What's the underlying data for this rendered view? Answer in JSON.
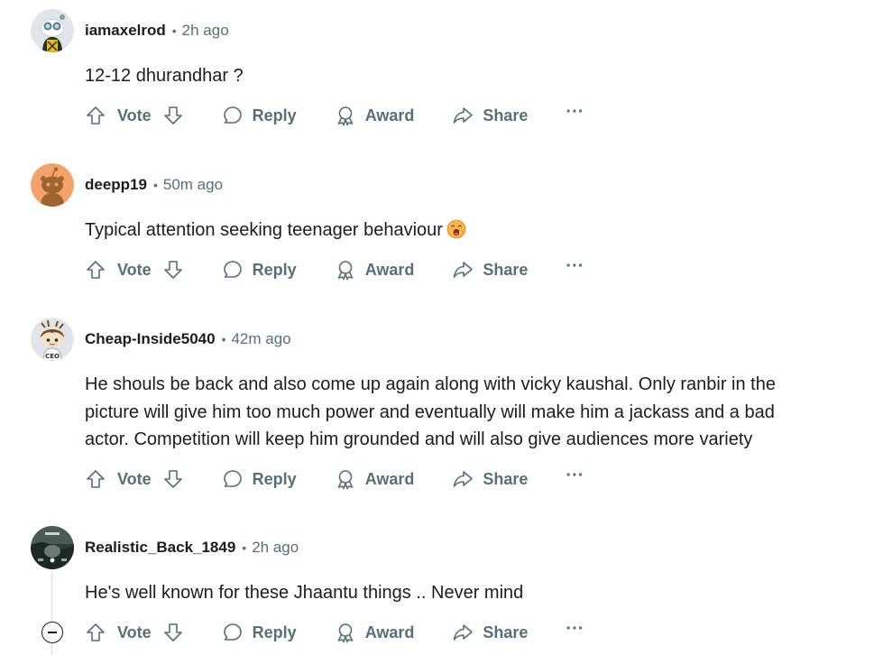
{
  "actions": {
    "vote": "Vote",
    "reply": "Reply",
    "award": "Award",
    "share": "Share",
    "more": "···"
  },
  "comments": [
    {
      "username": "iamaxelrod",
      "time": "2h ago",
      "text": "12-12 dhurandhar ?",
      "avatar_icon": "snoo-avatar-goggles"
    },
    {
      "username": "deepp19",
      "time": "50m ago",
      "text": "Typical attention seeking teenager behaviour",
      "emoji_icon": "yawning-face-emoji",
      "avatar_icon": "snoo-avatar-orange"
    },
    {
      "username": "Cheap-Inside5040",
      "time": "42m ago",
      "text_lines": [
        "He shouls be back and also come up again along with vicky kaushal. Only ranbir in the",
        "picture will give him too much power and eventually will make him a jackass and a bad",
        "actor. Competition will keep him grounded and will also give audiences more variety"
      ],
      "avatar_icon": "snoo-avatar-hair"
    },
    {
      "username": "Realistic_Back_1849",
      "time": "2h ago",
      "text": "He's well known for these Jhaantu things .. Never mind",
      "avatar_icon": "photo-avatar-dark"
    }
  ],
  "colors": {
    "meta_gray": "#576f76",
    "text": "#1c1c1c",
    "thread_line": "#d5dadb",
    "avatar_orange": "#f4a26b"
  }
}
